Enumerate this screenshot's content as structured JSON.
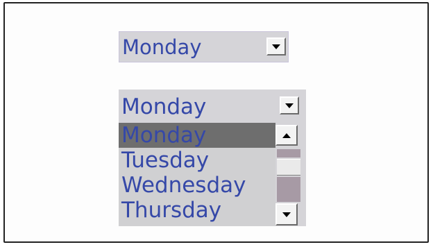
{
  "select_closed": {
    "value": "Monday",
    "arrow_icon": "chevron-down-icon"
  },
  "select_open": {
    "value": "Monday",
    "arrow_icon": "chevron-down-icon",
    "options": [
      "Monday",
      "Tuesday",
      "Wednesday",
      "Thursday"
    ],
    "selected_index": 0,
    "scroll_up_icon": "arrow-up-icon",
    "scroll_down_icon": "arrow-down-icon"
  },
  "colors": {
    "text": "#3548a8",
    "field_bg": "#d5d4d8",
    "selected_bg": "#6e6e6e",
    "scroll_track": "#a79aa5"
  }
}
